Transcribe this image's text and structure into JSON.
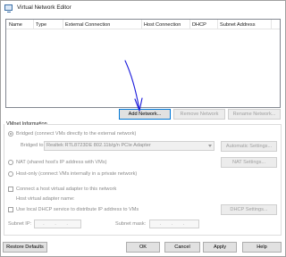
{
  "window": {
    "title": "Virtual Network Editor"
  },
  "table": {
    "columns": [
      "Name",
      "Type",
      "External Connection",
      "Host Connection",
      "DHCP",
      "Subnet Address"
    ]
  },
  "table_buttons": {
    "add": "Add Network...",
    "remove": "Remove Network",
    "rename": "Rename Network..."
  },
  "vmnet": {
    "group_label": "VMnet Information",
    "bridged_label": "Bridged (connect VMs directly to the external network)",
    "bridged_to_label": "Bridged to:",
    "bridged_to_value": "Realtek RTL8723DE 802.11b/g/n PCIe Adapter",
    "automatic_settings": "Automatic Settings...",
    "nat_label": "NAT (shared host's IP address with VMs)",
    "nat_settings": "NAT Settings...",
    "host_only_label": "Host-only (connect VMs internally in a private network)",
    "connect_adapter_label": "Connect a host virtual adapter to this network",
    "adapter_name_label": "Host virtual adapter name:",
    "dhcp_label": "Use local DHCP service to distribute IP address to VMs",
    "dhcp_settings": "DHCP Settings...",
    "subnet_ip_label": "Subnet IP:",
    "subnet_ip_value": ". . .",
    "subnet_mask_label": "Subnet mask:",
    "subnet_mask_value": ". . ."
  },
  "footer": {
    "restore_defaults": "Restore Defaults",
    "ok": "OK",
    "cancel": "Cancel",
    "apply": "Apply",
    "help": "Help"
  },
  "colors": {
    "annotation_arrow": "#1a1adb",
    "focus_border": "#0078d7"
  }
}
